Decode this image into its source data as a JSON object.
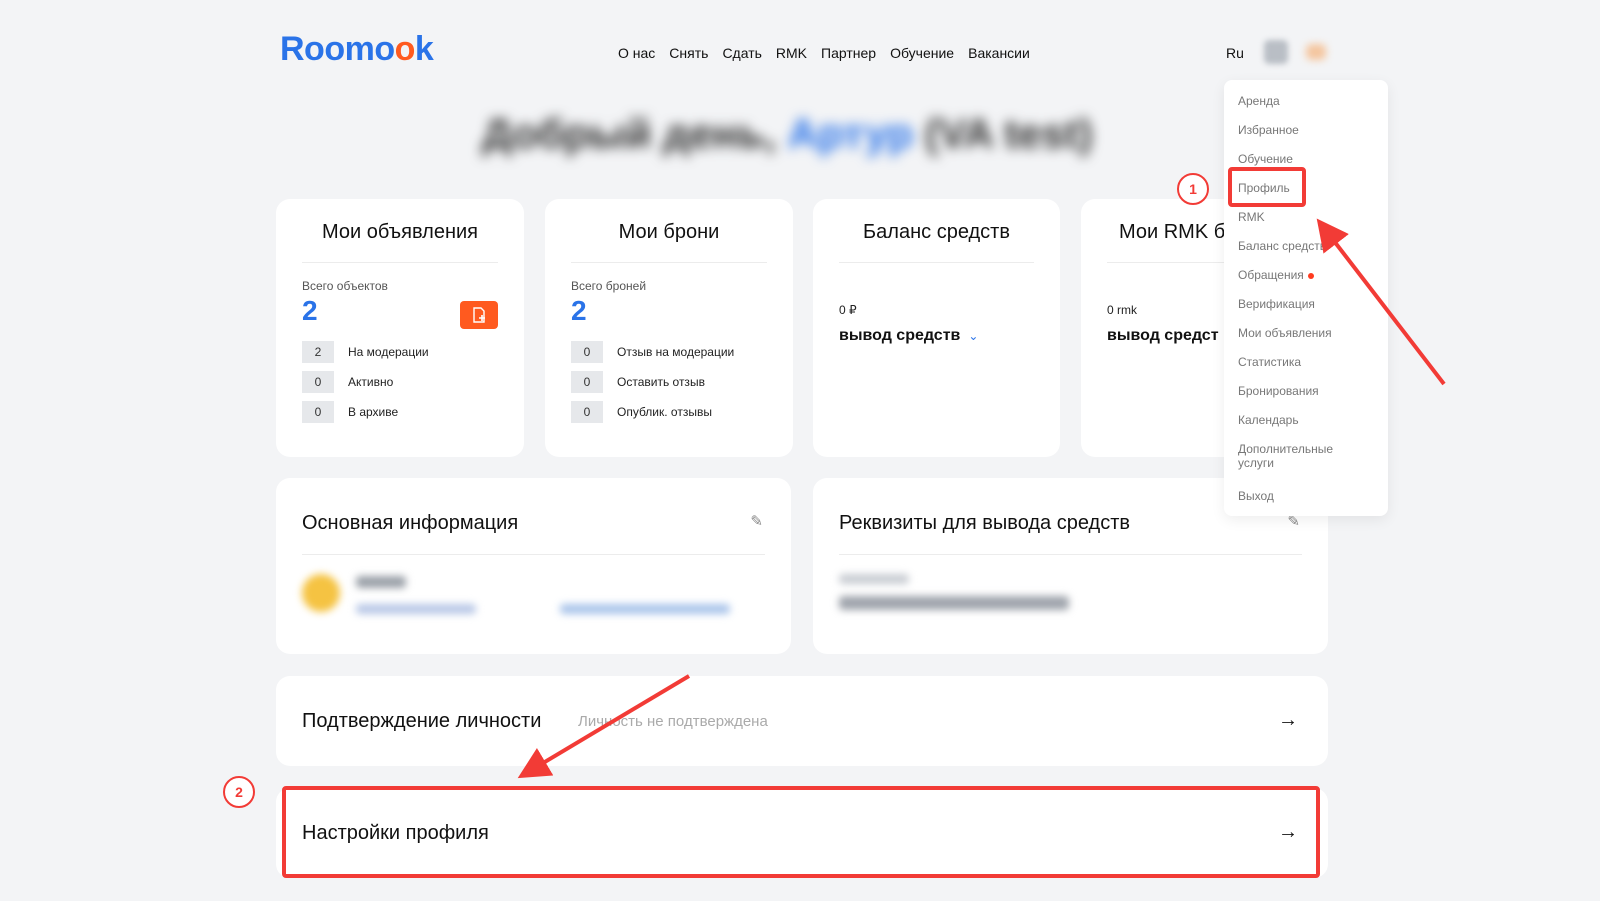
{
  "header": {
    "logo_prefix": "Roomo",
    "logo_o": "o",
    "logo_suffix": "k",
    "nav": [
      "О нас",
      "Снять",
      "Сдать",
      "RMK",
      "Партнер",
      "Обучение",
      "Вакансии"
    ],
    "lang": "Ru"
  },
  "greeting": {
    "prefix": "Добрый день, ",
    "name": "Артур",
    "suffix": " (VA test)"
  },
  "listings_card": {
    "title": "Мои объявления",
    "total_label": "Всего объектов",
    "total": "2",
    "add_icon": "add-document-icon",
    "rows": [
      {
        "count": "2",
        "label": "На модерации"
      },
      {
        "count": "0",
        "label": "Активно"
      },
      {
        "count": "0",
        "label": "В архиве"
      }
    ]
  },
  "bookings_card": {
    "title": "Мои брони",
    "total_label": "Всего броней",
    "total": "2",
    "rows": [
      {
        "count": "0",
        "label": "Отзыв на модерации"
      },
      {
        "count": "0",
        "label": "Оставить отзыв"
      },
      {
        "count": "0",
        "label": "Опублик. отзывы"
      }
    ]
  },
  "balance_card": {
    "title": "Баланс средств",
    "value": "0 ₽",
    "withdraw": "вывод средств"
  },
  "rmk_card": {
    "title": "Мои RMK б",
    "value": "0 rmk",
    "withdraw": "вывод средст"
  },
  "main_info": {
    "title": "Основная информация"
  },
  "requisites": {
    "title": "Реквизиты для вывода средств"
  },
  "verification": {
    "title": "Подтверждение личности",
    "status": "Личность не подтверждена"
  },
  "profile_settings": {
    "title": "Настройки профиля"
  },
  "dropdown": {
    "items": [
      "Аренда",
      "Избранное",
      "Обучение",
      "Профиль",
      "RMK",
      "Баланс средств",
      "Обращения",
      "Верификация",
      "Мои объявления",
      "Статистика",
      "Бронирования",
      "Календарь",
      "Дополнительные услуги",
      "Выход"
    ]
  },
  "annotations": {
    "step1": "1",
    "step2": "2"
  },
  "colors": {
    "brand_blue": "#2a73e8",
    "brand_orange": "#ff5a1f",
    "annotation_red": "#f23b36"
  }
}
